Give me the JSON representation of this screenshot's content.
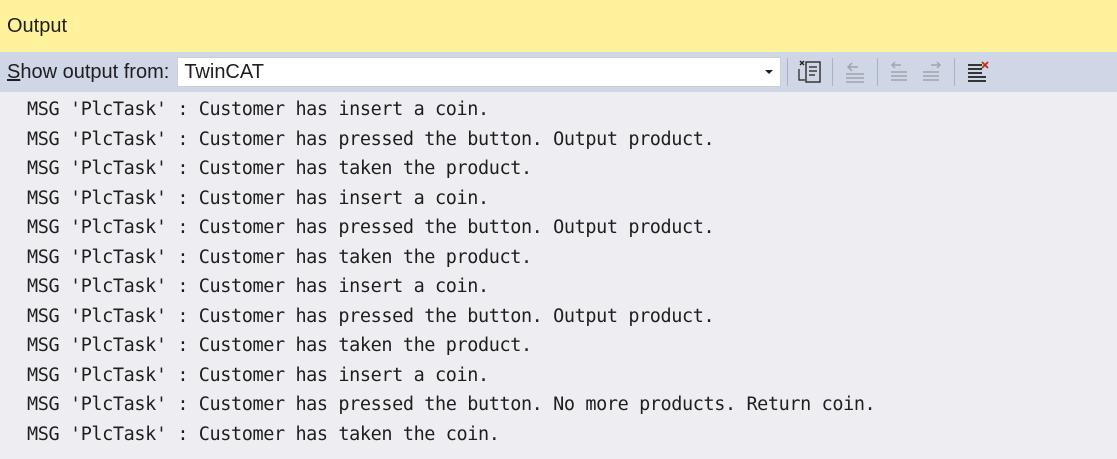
{
  "window": {
    "title": "Output"
  },
  "toolbar": {
    "show_output_prefix": "S",
    "show_output_rest": "how output from:",
    "source_selected": "TwinCAT",
    "buttons": [
      {
        "icon": "find-message-in-code-icon"
      },
      {
        "icon": "go-to-previous-message-icon"
      },
      {
        "icon": "go-to-next-message-icon"
      },
      {
        "icon": "clear-all-icon"
      },
      {
        "icon": "toggle-word-wrap-icon"
      }
    ]
  },
  "output": {
    "lines": [
      "MSG 'PlcTask' : Customer has insert a coin.",
      "MSG 'PlcTask' : Customer has pressed the button. Output product.",
      "MSG 'PlcTask' : Customer has taken the product.",
      "MSG 'PlcTask' : Customer has insert a coin.",
      "MSG 'PlcTask' : Customer has pressed the button. Output product.",
      "MSG 'PlcTask' : Customer has taken the product.",
      "MSG 'PlcTask' : Customer has insert a coin.",
      "MSG 'PlcTask' : Customer has pressed the button. Output product.",
      "MSG 'PlcTask' : Customer has taken the product.",
      "MSG 'PlcTask' : Customer has insert a coin.",
      "MSG 'PlcTask' : Customer has pressed the button. No more products. Return coin.",
      "MSG 'PlcTask' : Customer has taken the coin."
    ]
  },
  "colors": {
    "titlebar_bg": "#fff29d",
    "toolbar_bg": "#cfd6e5",
    "output_bg": "#eeeef2",
    "text": "#1e1e1e"
  }
}
